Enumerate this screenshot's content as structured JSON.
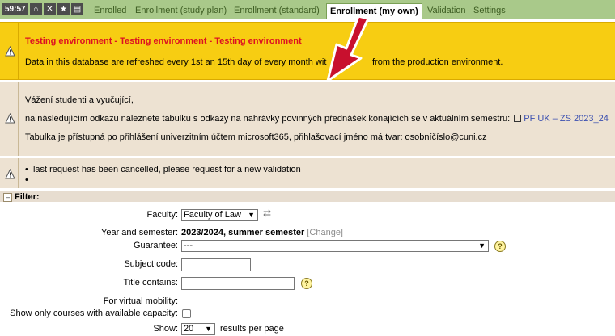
{
  "header": {
    "timer": "59:57",
    "icons": [
      "home-icon",
      "close-icon",
      "star-icon",
      "print-icon"
    ],
    "tabs": [
      {
        "label": "Enrolled",
        "active": false
      },
      {
        "label": "Enrollment (study plan)",
        "active": false
      },
      {
        "label": "Enrollment (standard)",
        "active": false
      },
      {
        "label": "Enrollment (my own)",
        "active": true
      },
      {
        "label": "Validation",
        "active": false
      },
      {
        "label": "Settings",
        "active": false
      }
    ]
  },
  "notice_test": {
    "title": "Testing environment - Testing environment - Testing environment",
    "body_before": "Data in this database are refreshed every 1st an 15th day of every month wit",
    "body_after": "from the production environment."
  },
  "notice_recordings": {
    "greeting": "Vážení studenti a vyučující,",
    "line2": "na následujícím odkazu naleznete tabulku s odkazy na nahrávky povinných přednášek konajících se v aktuálním semestru:",
    "link": "PF UK – ZS 2023_24",
    "line3": "Tabulka je přístupná po přihlášení univerzitním účtem microsoft365, přihlašovací jméno má tvar: osobníčíslo@cuni.cz"
  },
  "notice_validation": {
    "items": [
      "last request has been cancelled, please request for a new validation",
      ""
    ]
  },
  "filter": {
    "title": "Filter:",
    "faculty_label": "Faculty:",
    "faculty_value": "Faculty of Law",
    "year_label": "Year and semester:",
    "year_value": "2023/2024, summer semester",
    "change_link": "[Change]",
    "guarantee_label": "Guarantee:",
    "guarantee_value": "---",
    "subject_code_label": "Subject code:",
    "subject_code_value": "",
    "title_contains_label": "Title contains:",
    "title_contains_value": "",
    "virtual_label": "For virtual mobility:",
    "capacity_label": "Show only courses with available capacity:",
    "show_label": "Show:",
    "show_value": "20",
    "show_suffix": "results per page"
  },
  "colors": {
    "tabbar": "#a9c98a",
    "warning_yellow": "#f7cd12",
    "notice_beige": "#ede2d2",
    "title_red": "#dd1122",
    "link_blue": "#3a4fb0",
    "annotation_arrow": "#c8102e"
  }
}
